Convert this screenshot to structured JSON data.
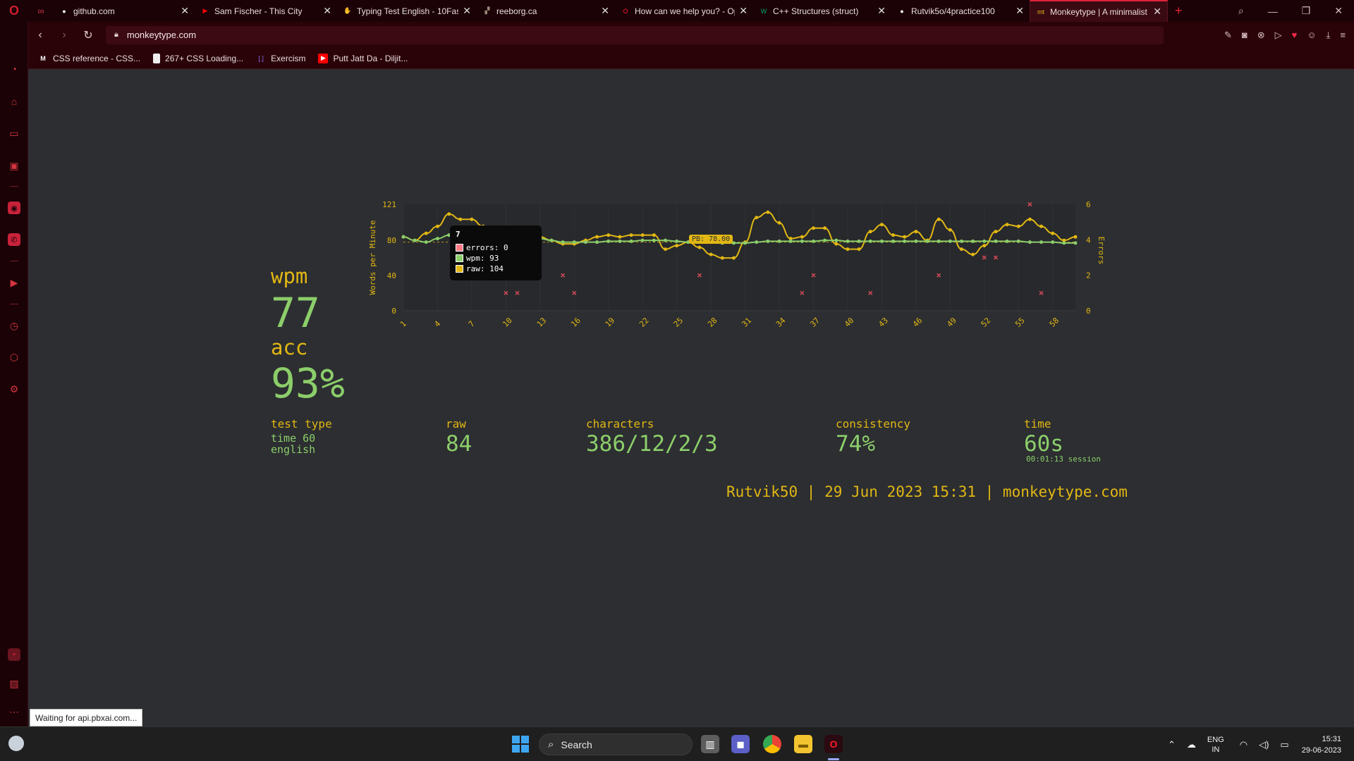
{
  "tabs": [
    {
      "title": "github.com",
      "favicon": "github-icon",
      "color": "#ffffff"
    },
    {
      "title": "Sam Fischer - This City",
      "favicon": "youtube-icon",
      "color": "#ff0000"
    },
    {
      "title": "Typing Test English - 10Fast",
      "favicon": "10fastfingers-icon",
      "color": "#7bb661"
    },
    {
      "title": "reeborg.ca",
      "favicon": "reeborg-icon",
      "color": "#9a8a7a"
    },
    {
      "title": "How can we help you? - Op",
      "favicon": "opera-icon",
      "color": "#ff1b2d"
    },
    {
      "title": "C++ Structures (struct)",
      "favicon": "w3schools-icon",
      "color": "#04aa6d"
    },
    {
      "title": "Rutvik5o/4practice100",
      "favicon": "github-icon",
      "color": "#ffffff"
    },
    {
      "title": "Monkeytype | A minimalist",
      "favicon": "monkeytype-icon",
      "color": "#e2b714"
    }
  ],
  "address": {
    "url": "monkeytype.com"
  },
  "bookmarks": [
    {
      "label": "CSS reference - CSS...",
      "icon": "mdn-icon"
    },
    {
      "label": "267+ CSS Loading...",
      "icon": "page-icon"
    },
    {
      "label": "Exercism",
      "icon": "exercism-icon"
    },
    {
      "label": "Putt Jatt Da - Diljit...",
      "icon": "youtube-icon"
    }
  ],
  "result": {
    "wpm_label": "wpm",
    "wpm": "77",
    "acc_label": "acc",
    "acc": "93%",
    "test_type_label": "test type",
    "test_type_line1": "time 60",
    "test_type_line2": "english",
    "raw_label": "raw",
    "raw": "84",
    "characters_label": "characters",
    "characters": "386/12/2/3",
    "consistency_label": "consistency",
    "consistency": "74%",
    "time_label": "time",
    "time": "60s",
    "session": "00:01:13 session",
    "footer": "Rutvik50 | 29 Jun 2023 15:31 | monkeytype.com"
  },
  "tooltip": {
    "title": "7",
    "errors": "errors: 0",
    "wpm": "wpm: 93",
    "raw": "raw: 104"
  },
  "pb_label": "PB: 78.00",
  "status_toast": "Waiting for api.pbxai.com...",
  "taskbar": {
    "search_placeholder": "Search",
    "lang_line1": "ENG",
    "lang_line2": "IN",
    "time": "15:31",
    "date": "29-06-2023"
  },
  "colors": {
    "main": "#e2b714",
    "text": "#8cce6a",
    "bg": "#2c2e31",
    "error": "#ca4754"
  },
  "chart_data": {
    "type": "line",
    "ylabel": "Words per Minute",
    "y2label": "Errors",
    "ylim": [
      0,
      121
    ],
    "y2lim": [
      0,
      6
    ],
    "yticks": [
      0,
      40,
      80,
      121
    ],
    "y2ticks": [
      0,
      2,
      4,
      6
    ],
    "xticks": [
      1,
      4,
      7,
      10,
      13,
      16,
      19,
      22,
      25,
      28,
      31,
      34,
      37,
      40,
      43,
      46,
      49,
      52,
      55,
      58
    ],
    "pb": 78,
    "x": [
      1,
      2,
      3,
      4,
      5,
      6,
      7,
      8,
      9,
      10,
      11,
      12,
      13,
      14,
      15,
      16,
      17,
      18,
      19,
      20,
      21,
      22,
      23,
      24,
      25,
      26,
      27,
      28,
      29,
      30,
      31,
      32,
      33,
      34,
      35,
      36,
      37,
      38,
      39,
      40,
      41,
      42,
      43,
      44,
      45,
      46,
      47,
      48,
      49,
      50,
      51,
      52,
      53,
      54,
      55,
      56,
      57,
      58,
      59,
      60
    ],
    "series": [
      {
        "name": "raw",
        "color": "#e2b714",
        "values": [
          84,
          80,
          88,
          96,
          110,
          104,
          104,
          96,
          92,
          84,
          84,
          88,
          84,
          80,
          76,
          76,
          80,
          84,
          86,
          84,
          86,
          86,
          86,
          70,
          74,
          78,
          72,
          64,
          60,
          60,
          78,
          106,
          112,
          100,
          82,
          84,
          94,
          94,
          76,
          70,
          70,
          90,
          98,
          86,
          84,
          90,
          80,
          104,
          92,
          70,
          64,
          74,
          90,
          98,
          96,
          104,
          96,
          88,
          80,
          84,
          76,
          78,
          72,
          66
        ]
      },
      {
        "name": "wpm",
        "color": "#8cce6a",
        "values": [
          84,
          80,
          78,
          82,
          86,
          90,
          93,
          92,
          90,
          88,
          86,
          84,
          82,
          80,
          78,
          78,
          78,
          78,
          79,
          79,
          79,
          80,
          80,
          80,
          79,
          78,
          78,
          78,
          77,
          77,
          77,
          78,
          79,
          79,
          79,
          79,
          79,
          80,
          80,
          79,
          79,
          79,
          79,
          79,
          79,
          79,
          79,
          79,
          79,
          79,
          79,
          79,
          79,
          79,
          79,
          78,
          78,
          78,
          77,
          77,
          77,
          77,
          77,
          77
        ]
      },
      {
        "name": "errors",
        "color": "#ca4754",
        "points": [
          [
            10,
            1
          ],
          [
            11,
            1
          ],
          [
            15,
            2
          ],
          [
            16,
            1
          ],
          [
            27,
            2
          ],
          [
            36,
            1
          ],
          [
            37,
            2
          ],
          [
            42,
            1
          ],
          [
            48,
            2
          ],
          [
            52,
            3
          ],
          [
            53,
            3
          ],
          [
            56,
            6
          ],
          [
            57,
            1
          ]
        ]
      }
    ]
  }
}
